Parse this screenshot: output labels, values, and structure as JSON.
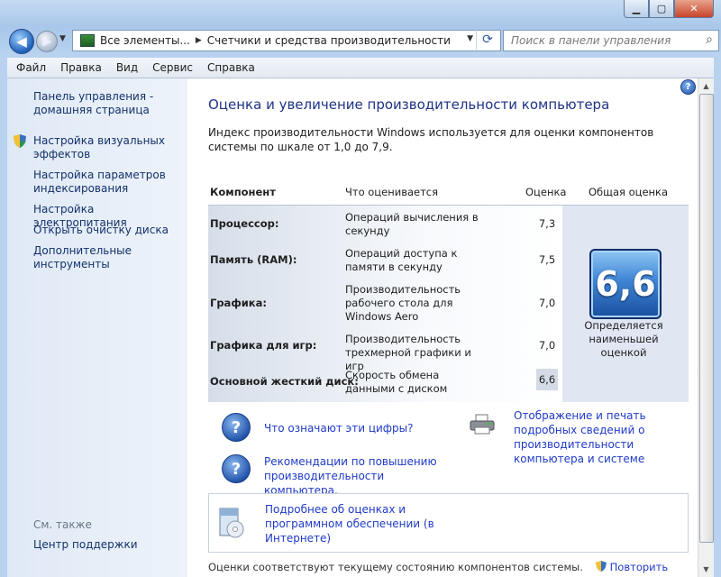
{
  "window": {
    "controls": {
      "minimize": "▁",
      "maximize": "▢",
      "close": "✕"
    }
  },
  "address": {
    "crumbs": [
      "Все элементы...",
      "Счетчики и средства производительности"
    ],
    "search_placeholder": "Поиск в панели управления"
  },
  "menu": [
    "Файл",
    "Правка",
    "Вид",
    "Сервис",
    "Справка"
  ],
  "sidebar": {
    "home": "Панель управления - домашняя страница",
    "items": [
      "Настройка визуальных эффектов",
      "Настройка параметров индексирования",
      "Настройка электропитания",
      "Открыть очистку диска",
      "Дополнительные инструменты"
    ],
    "see_also": "См. также",
    "support": "Центр поддержки"
  },
  "main": {
    "title": "Оценка и увеличение производительности компьютера",
    "intro": "Индекс производительности Windows используется для оценки компонентов системы по шкале от 1,0 до 7,9.",
    "headers": {
      "component": "Компонент",
      "what": "Что оценивается",
      "score": "Оценка",
      "total": "Общая оценка"
    },
    "rows": [
      {
        "component": "Процессор:",
        "what": "Операций вычисления в секунду",
        "score": "7,3"
      },
      {
        "component": "Память (RAM):",
        "what": "Операций доступа к памяти в секунду",
        "score": "7,5"
      },
      {
        "component": "Графика:",
        "what": "Производительность рабочего стола для Windows Aero",
        "score": "7,0"
      },
      {
        "component": "Графика для игр:",
        "what": "Производительность трехмерной графики и игр",
        "score": "7,0"
      },
      {
        "component": "Основной жесткий диск:",
        "what": "Скорость обмена данными с диском",
        "score": "6,6"
      }
    ],
    "base_score": "6,6",
    "base_caption": "Определяется наименьшей оценкой",
    "links": {
      "meaning": "Что означают эти цифры?",
      "tips": "Рекомендации по повышению производительности компьютера.",
      "print": "Отображение и печать подробных сведений о производительности компьютера и системе",
      "online": "Подробнее об оценках и программном обеспечении (в Интернете)"
    },
    "footer": "Оценки соответствуют текущему состоянию компонентов системы.",
    "rerun": "Повторить оценку"
  }
}
